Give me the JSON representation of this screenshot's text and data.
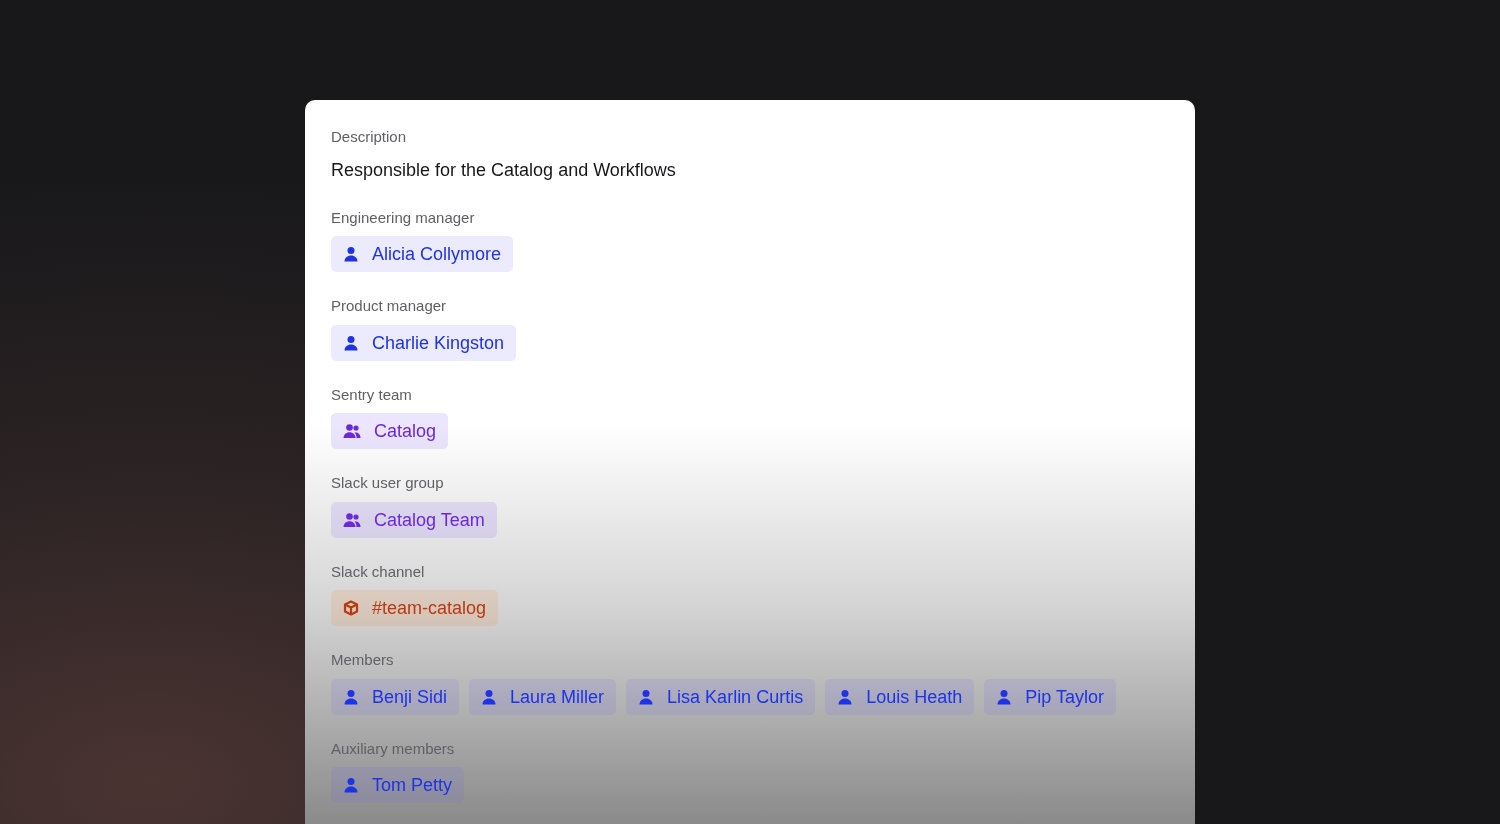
{
  "fields": [
    {
      "label": "Description",
      "kind": "text",
      "value": "Responsible for the Catalog and Workflows"
    },
    {
      "label": "Engineering manager",
      "kind": "chips",
      "chips": [
        {
          "kind": "user",
          "text": "Alicia Collymore"
        }
      ]
    },
    {
      "label": "Product manager",
      "kind": "chips",
      "chips": [
        {
          "kind": "user",
          "text": "Charlie Kingston"
        }
      ]
    },
    {
      "label": "Sentry team",
      "kind": "chips",
      "chips": [
        {
          "kind": "team",
          "text": "Catalog"
        }
      ]
    },
    {
      "label": "Slack user group",
      "kind": "chips",
      "chips": [
        {
          "kind": "team",
          "text": "Catalog Team"
        }
      ]
    },
    {
      "label": "Slack channel",
      "kind": "chips",
      "chips": [
        {
          "kind": "channel",
          "text": "#team-catalog"
        }
      ]
    },
    {
      "label": "Members",
      "kind": "chips",
      "chips": [
        {
          "kind": "user",
          "text": "Benji Sidi"
        },
        {
          "kind": "user",
          "text": "Laura Miller"
        },
        {
          "kind": "user",
          "text": "Lisa Karlin Curtis"
        },
        {
          "kind": "user",
          "text": "Louis Heath"
        },
        {
          "kind": "user",
          "text": "Pip Taylor"
        }
      ]
    },
    {
      "label": "Auxiliary members",
      "kind": "chips",
      "chips": [
        {
          "kind": "user",
          "text": "Tom Petty"
        }
      ]
    }
  ]
}
